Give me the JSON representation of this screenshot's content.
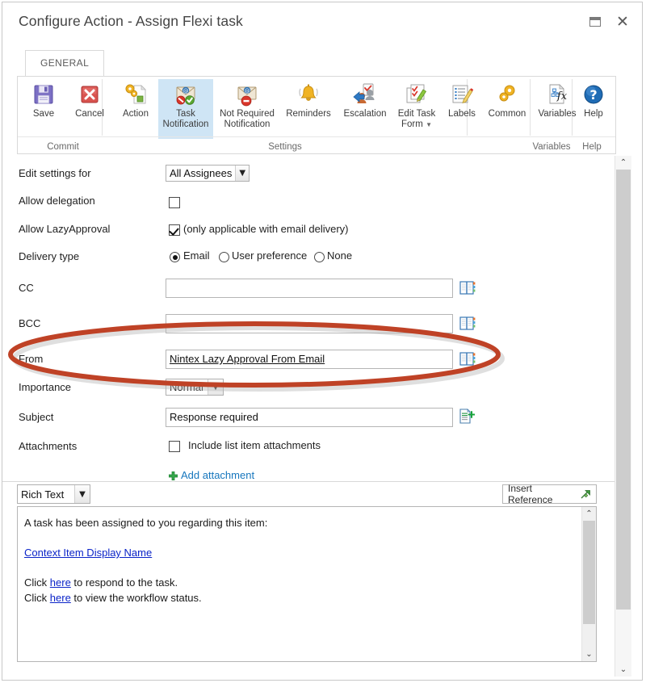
{
  "window": {
    "title": "Configure Action - Assign Flexi task",
    "restore_icon": "restore-icon",
    "close_icon": "close-icon"
  },
  "ribbon": {
    "tab_label": "GENERAL",
    "groups": [
      {
        "name": "Commit",
        "label": "Commit"
      },
      {
        "name": "Settings",
        "label": "Settings"
      },
      {
        "name": "Variables",
        "label": "Variables"
      },
      {
        "name": "Help",
        "label": "Help"
      }
    ],
    "buttons": [
      {
        "id": "save",
        "label": "Save",
        "line2": "",
        "icon": "floppy-disk-icon",
        "selected": false
      },
      {
        "id": "cancel",
        "label": "Cancel",
        "line2": "",
        "icon": "red-x-icon",
        "selected": false
      },
      {
        "id": "action",
        "label": "Action",
        "line2": "",
        "icon": "gears-document-icon",
        "selected": false
      },
      {
        "id": "task-notification",
        "label": "Task",
        "line2": "Notification",
        "icon": "envelope-check-icon",
        "selected": true
      },
      {
        "id": "not-required-notification",
        "label": "Not Required",
        "line2": "Notification",
        "icon": "envelope-block-icon",
        "selected": false
      },
      {
        "id": "reminders",
        "label": "Reminders",
        "line2": "",
        "icon": "bell-icon",
        "selected": false
      },
      {
        "id": "escalation",
        "label": "Escalation",
        "line2": "",
        "icon": "escalation-people-icon",
        "selected": false
      },
      {
        "id": "edit-task-form",
        "label": "Edit Task",
        "line2": "Form",
        "icon": "task-form-icon",
        "selected": false,
        "has_dropdown": true
      },
      {
        "id": "labels",
        "label": "Labels",
        "line2": "",
        "icon": "labels-pencil-icon",
        "selected": false
      },
      {
        "id": "common",
        "label": "Common",
        "line2": "",
        "icon": "gears-icon",
        "selected": false
      },
      {
        "id": "variables",
        "label": "Variables",
        "line2": "",
        "icon": "variables-fx-icon",
        "selected": false
      },
      {
        "id": "help",
        "label": "Help",
        "line2": "",
        "icon": "help-question-icon",
        "selected": false
      }
    ]
  },
  "form": {
    "edit_settings_for": {
      "label": "Edit settings for",
      "value": "All Assignees"
    },
    "allow_delegation": {
      "label": "Allow delegation",
      "checked": false
    },
    "allow_lazy_approval": {
      "label": "Allow LazyApproval",
      "checked": true,
      "note": "(only applicable with email delivery)"
    },
    "delivery_type": {
      "label": "Delivery type",
      "options": [
        {
          "label": "Email",
          "selected": true
        },
        {
          "label": "User preference",
          "selected": false
        },
        {
          "label": "None",
          "selected": false
        }
      ]
    },
    "cc": {
      "label": "CC",
      "value": "",
      "picker_icon": "address-book-icon"
    },
    "bcc": {
      "label": "BCC",
      "value": "",
      "picker_icon": "address-book-icon"
    },
    "from": {
      "label": "From",
      "value": "Nintex Lazy Approval From Email",
      "picker_icon": "address-book-icon",
      "highlighted": true
    },
    "importance": {
      "label": "Importance",
      "value": "Normal"
    },
    "subject": {
      "label": "Subject",
      "value": "Response required",
      "insert_icon": "insert-reference-doc-icon"
    },
    "attachments": {
      "label": "Attachments",
      "checkbox_label": "Include list item attachments",
      "checked": false,
      "add_link": "Add attachment",
      "add_icon": "green-plus-icon"
    }
  },
  "editor": {
    "format": "Rich Text",
    "insert_reference_label": "Insert Reference",
    "insert_reference_icon": "insert-reference-arrow-icon",
    "content": {
      "intro": "A task has been assigned to you regarding this item:",
      "item_link": "Context Item Display Name",
      "line_respond_prefix": "Click ",
      "line_respond_link": "here",
      "line_respond_suffix": " to respond to the task.",
      "line_status_prefix": "Click ",
      "line_status_link": "here",
      "line_status_suffix": " to view the workflow status."
    }
  },
  "annotation": {
    "shape": "ellipse-highlight",
    "target": "From field",
    "color": "#bf4226"
  },
  "scrollbars": {
    "up_arrow": "⌃",
    "down_arrow": "⌄"
  },
  "colors": {
    "accent_selected": "#cfe5f5",
    "link": "#1676bd",
    "annotation": "#bf4226"
  }
}
